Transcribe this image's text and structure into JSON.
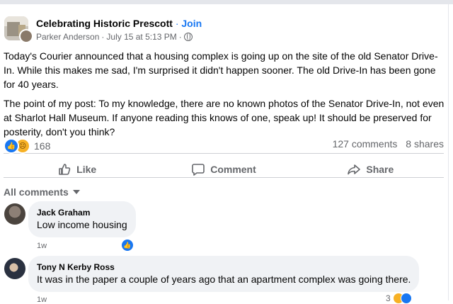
{
  "post": {
    "group_name": "Celebrating Historic Prescott",
    "separator": "·",
    "join_label": "Join",
    "author": "Parker Anderson",
    "timestamp": "July 15 at 5:13 PM",
    "paragraphs": [
      "Today's Courier announced that a housing complex is going up on the site of the old Senator Drive-In.  While this makes me sad, I'm surprised it didn't happen sooner.  The old Drive-In has been gone for 40 years.",
      "The point of my post:  To my knowledge, there are no known photos of the Senator Drive-In, not even at Sharlot Hall Museum.  If anyone reading this knows of one, speak up!  It should be preserved for posterity, don't you think?"
    ],
    "reaction_count": "168",
    "comments_count": "127 comments",
    "shares_count": "8 shares"
  },
  "actions": {
    "like": "Like",
    "comment": "Comment",
    "share": "Share"
  },
  "comments_filter": "All comments",
  "comments": [
    {
      "name": "Jack Graham",
      "text": "Low income housing",
      "time": "1w"
    },
    {
      "name": "Tony N Kerby Ross",
      "text": "It was in the paper a couple of years ago that an apartment complex was going there.",
      "time": "1w",
      "reaction_count": "3"
    }
  ],
  "colors": {
    "accent": "#1877f2",
    "muted": "#65676b",
    "bubble": "#f0f2f5"
  },
  "icons": [
    "globe-icon",
    "like-reaction-icon",
    "sad-reaction-icon",
    "thumbs-up-icon",
    "comment-icon",
    "share-icon",
    "caret-down-icon"
  ]
}
